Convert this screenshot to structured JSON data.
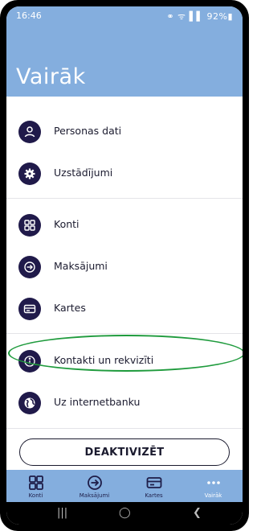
{
  "status_bar": {
    "time": "16:46",
    "icons": "⚭ ᯤ ▌▌ 92%▮"
  },
  "page_title": "Vairāk",
  "menu": {
    "group1": [
      {
        "label": "Personas dati",
        "icon": "person-icon"
      },
      {
        "label": "Uzstādījumi",
        "icon": "gear-icon"
      }
    ],
    "group2": [
      {
        "label": "Konti",
        "icon": "accounts-grid-icon"
      },
      {
        "label": "Maksājumi",
        "icon": "payment-arrow-icon"
      },
      {
        "label": "Kartes",
        "icon": "card-icon"
      }
    ],
    "group3": [
      {
        "label": "Kontakti un rekvizīti",
        "icon": "info-icon"
      },
      {
        "label": "Uz internetbanku",
        "icon": "globe-icon"
      }
    ]
  },
  "deactivate_button": "DEAKTIVIZĒT",
  "tabs": [
    {
      "label": "Konti",
      "icon": "accounts-grid-icon"
    },
    {
      "label": "Maksājumi",
      "icon": "payment-arrow-icon"
    },
    {
      "label": "Kartes",
      "icon": "card-icon"
    },
    {
      "label": "Vairāk",
      "icon": "more-dots-icon",
      "active": true
    }
  ],
  "system_nav": {
    "recent": "|||",
    "home": "◯",
    "back": "❮"
  },
  "colors": {
    "header": "#84aede",
    "icon_circle": "#201a4a",
    "highlight_ring": "#1f9b3d"
  }
}
